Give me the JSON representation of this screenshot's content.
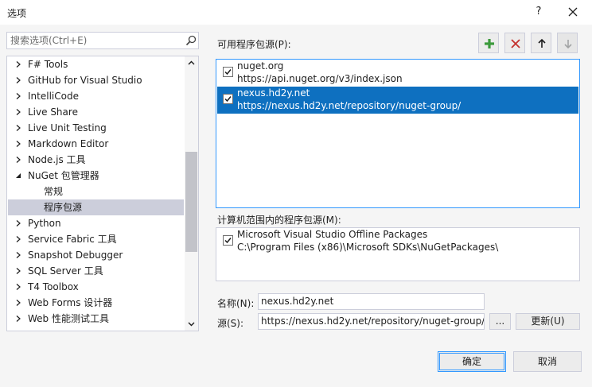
{
  "window": {
    "title": "选项",
    "help_label": "?",
    "close_icon": "close-icon"
  },
  "search": {
    "placeholder": "搜索选项(Ctrl+E)",
    "icon": "search-icon"
  },
  "tree": {
    "items": [
      {
        "label": "F# Tools",
        "expanded": false,
        "indent": 0,
        "selected": false
      },
      {
        "label": "GitHub for Visual Studio",
        "expanded": false,
        "indent": 0,
        "selected": false
      },
      {
        "label": "IntelliCode",
        "expanded": false,
        "indent": 0,
        "selected": false
      },
      {
        "label": "Live Share",
        "expanded": false,
        "indent": 0,
        "selected": false
      },
      {
        "label": "Live Unit Testing",
        "expanded": false,
        "indent": 0,
        "selected": false
      },
      {
        "label": "Markdown Editor",
        "expanded": false,
        "indent": 0,
        "selected": false
      },
      {
        "label": "Node.js 工具",
        "expanded": false,
        "indent": 0,
        "selected": false
      },
      {
        "label": "NuGet 包管理器",
        "expanded": true,
        "indent": 0,
        "selected": false
      },
      {
        "label": "常规",
        "expanded": null,
        "indent": 1,
        "selected": false
      },
      {
        "label": "程序包源",
        "expanded": null,
        "indent": 1,
        "selected": true
      },
      {
        "label": "Python",
        "expanded": false,
        "indent": 0,
        "selected": false
      },
      {
        "label": "Service Fabric 工具",
        "expanded": false,
        "indent": 0,
        "selected": false
      },
      {
        "label": "Snapshot Debugger",
        "expanded": false,
        "indent": 0,
        "selected": false
      },
      {
        "label": "SQL Server 工具",
        "expanded": false,
        "indent": 0,
        "selected": false
      },
      {
        "label": "T4 Toolbox",
        "expanded": false,
        "indent": 0,
        "selected": false
      },
      {
        "label": "Web Forms 设计器",
        "expanded": false,
        "indent": 0,
        "selected": false
      },
      {
        "label": "Web 性能测试工具",
        "expanded": false,
        "indent": 0,
        "selected": false
      }
    ]
  },
  "sources": {
    "label": "可用程序包源(P):",
    "toolbar": {
      "add_icon": "plus-icon",
      "remove_icon": "remove-x-icon",
      "up_icon": "arrow-up-icon",
      "down_icon": "arrow-down-icon",
      "add_color": "#3c9a3c",
      "remove_color": "#c4312e"
    },
    "items": [
      {
        "name": "nuget.org",
        "url": "https://api.nuget.org/v3/index.json",
        "checked": true,
        "selected": false
      },
      {
        "name": "nexus.hd2y.net",
        "url": "https://nexus.hd2y.net/repository/nuget-group/",
        "checked": true,
        "selected": true
      }
    ]
  },
  "machine_sources": {
    "label": "计算机范围内的程序包源(M):",
    "items": [
      {
        "name": "Microsoft Visual Studio Offline Packages",
        "url": "C:\\Program Files (x86)\\Microsoft SDKs\\NuGetPackages\\",
        "checked": true
      }
    ]
  },
  "form": {
    "name_label": "名称(N):",
    "name_value": "nexus.hd2y.net",
    "source_label": "源(S):",
    "source_value": "https://nexus.hd2y.net/repository/nuget-group/",
    "browse_label": "...",
    "update_label": "更新(U)"
  },
  "footer": {
    "ok_label": "确定",
    "cancel_label": "取消"
  },
  "colors": {
    "selection": "#0e70c0",
    "tree_selection": "#cccedb",
    "accent_border": "#3399ff"
  }
}
